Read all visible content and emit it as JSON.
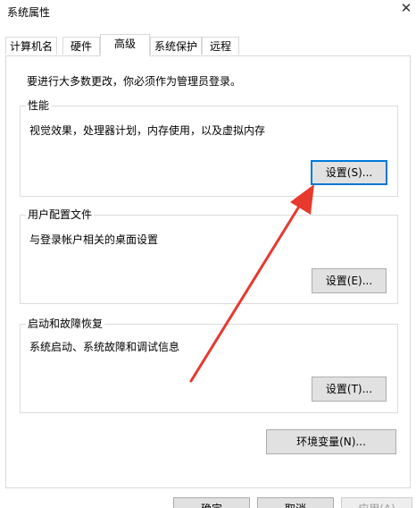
{
  "window": {
    "title": "系统属性"
  },
  "tabs": [
    {
      "label": "计算机名"
    },
    {
      "label": "硬件"
    },
    {
      "label": "高级"
    },
    {
      "label": "系统保护"
    },
    {
      "label": "远程"
    }
  ],
  "active_tab": "高级",
  "main": {
    "note": "要进行大多数更改，你必须作为管理员登录。",
    "performance": {
      "title": "性能",
      "description": "视觉效果，处理器计划，内存使用，以及虚拟内存",
      "button_label": "设置(S)..."
    },
    "user_profiles": {
      "title": "用户配置文件",
      "description": "与登录帐户相关的桌面设置",
      "button_label": "设置(E)..."
    },
    "startup_recovery": {
      "title": "启动和故障恢复",
      "description": "系统启动、系统故障和调试信息",
      "button_label": "设置(T)..."
    },
    "env_button_label": "环境变量(N)..."
  },
  "footer": {
    "ok_label": "确定",
    "cancel_label": "取消",
    "apply_label": "应用(A)"
  },
  "colors": {
    "accent": "#0078d7",
    "annotation_arrow": "#e8392f"
  },
  "icons": {
    "close": "close-icon"
  }
}
